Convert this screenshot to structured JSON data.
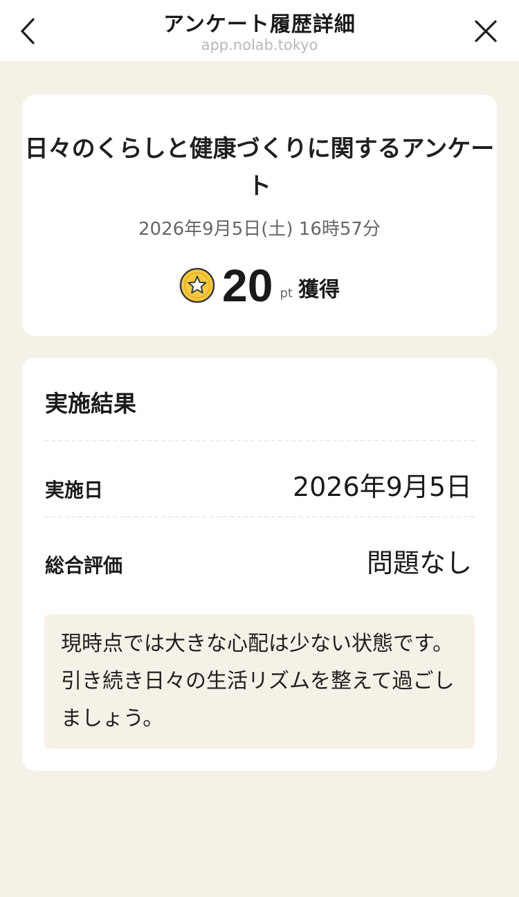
{
  "header": {
    "title": "アンケート履歴詳細",
    "domain": "app.nolab.tokyo",
    "back_icon": "chevron-left-icon",
    "close_icon": "close-icon"
  },
  "survey": {
    "title": "日々のくらしと健康づくりに関するアンケート",
    "datetime": "2026年9月5日(土) 16時57分",
    "points_icon": "star-coin-icon",
    "points_value": "20",
    "points_unit": "pt",
    "points_suffix": "獲得"
  },
  "result": {
    "heading": "実施結果",
    "rows": [
      {
        "label": "実施日",
        "value": "2026年9月5日"
      },
      {
        "label": "総合評価",
        "value": "問題なし"
      }
    ],
    "comment": "現時点では大きな心配は少ない状態です。引き続き日々の生活リズムを整えて過ごしましょう。"
  },
  "colors": {
    "background": "#f6f1e7",
    "card": "#ffffff",
    "coin_fill": "#f6c940",
    "coin_border": "#3a3a3a"
  }
}
